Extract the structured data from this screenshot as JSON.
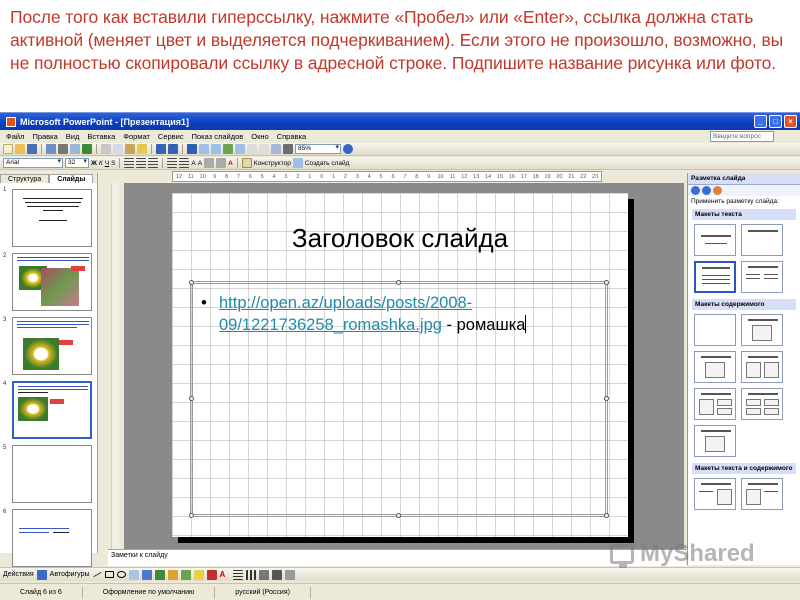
{
  "caption": {
    "text": "После того как вставили гиперссылку, нажмите «Пробел» или «Enter», ссылка должна стать активной (меняет цвет и выделяется подчеркиванием). Если этого не произошло, возможно, вы не полностью скопировали ссылку в адресной строке. Подпишите название рисунка или фото.",
    "color": "#c0392b"
  },
  "window": {
    "title": "Microsoft PowerPoint - [Презентация1]",
    "buttons": [
      "_",
      "□",
      "×"
    ]
  },
  "menu": {
    "items": [
      "Файл",
      "Правка",
      "Вид",
      "Вставка",
      "Формат",
      "Сервис",
      "Показ слайдов",
      "Окно",
      "Справка"
    ],
    "help_placeholder": "Введите вопрос"
  },
  "toolbar": {
    "zoom": "85%",
    "font": "Arial",
    "font_size": "32",
    "designer_label": "Конструктор",
    "new_slide_label": "Создать слайд"
  },
  "ruler": {
    "labels": [
      "12",
      "11",
      "10",
      "9",
      "8",
      "7",
      "6",
      "5",
      "4",
      "3",
      "2",
      "1",
      "0",
      "1",
      "2",
      "3",
      "4",
      "5",
      "6",
      "7",
      "8",
      "9",
      "10",
      "11",
      "12",
      "13",
      "14",
      "15",
      "16",
      "17",
      "18",
      "19",
      "20",
      "21",
      "22",
      "23"
    ]
  },
  "outline": {
    "tabs": [
      "Структура",
      "Слайды"
    ],
    "slide_numbers": [
      "1",
      "2",
      "3",
      "4",
      "5",
      "6"
    ]
  },
  "slide": {
    "title": "Заголовок слайда",
    "link_text": "http://open.az/uploads/posts/2008-09/1221736258_romashka.jpg",
    "link_line1": "http://open.az/uploads/posts/2008-",
    "link_line2": "09/1221736258_romashka.jpg",
    "suffix": " - ромашка",
    "bullet": "•",
    "link_color": "#1f8bab"
  },
  "notes": {
    "placeholder": "Заметки к слайду"
  },
  "taskpane": {
    "title": "Разметка слайда",
    "apply_label": "Применить разметку слайда:",
    "section_text": "Макеты текста",
    "section_content": "Макеты содержимого",
    "section_text_content": "Макеты текста и содержимого"
  },
  "drawbar": {
    "actions_label": "Действия",
    "autoshapes_label": "Автофигуры"
  },
  "status": {
    "slide_info": "Слайд 6 из 6",
    "design": "Оформление по умолчанию",
    "language": "русский (Россия)"
  },
  "watermark": {
    "text": "MyShared"
  }
}
